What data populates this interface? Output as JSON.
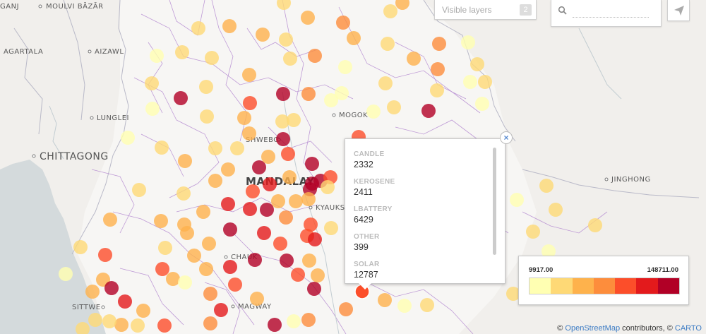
{
  "cities": [
    {
      "name": "GANJ"
    },
    {
      "name": "MOULVI BĀZĀR"
    },
    {
      "name": "AGARTALA"
    },
    {
      "name": "AIZAWL"
    },
    {
      "name": "LUNGLEI"
    },
    {
      "name": "CHITTAGONG"
    },
    {
      "name": "SHWEBO"
    },
    {
      "name": "MANDALAY"
    },
    {
      "name": "KYAUKSE"
    },
    {
      "name": "MOGOK"
    },
    {
      "name": "CHAUK"
    },
    {
      "name": "MAGWAY"
    },
    {
      "name": "SITTWE"
    },
    {
      "name": "JINGHONG"
    }
  ],
  "layers_control": {
    "label": "Visible layers",
    "count": "2"
  },
  "search": {
    "placeholder": ""
  },
  "popup": {
    "fields": [
      {
        "name": "CANDLE",
        "value": "2332"
      },
      {
        "name": "KEROSENE",
        "value": "2411"
      },
      {
        "name": "LBATTERY",
        "value": "6429"
      },
      {
        "name": "OTHER",
        "value": "399"
      },
      {
        "name": "SOLAR",
        "value": "12787"
      }
    ]
  },
  "legend": {
    "min": "9917.00",
    "max": "148711.00",
    "colors": [
      "#ffffb2",
      "#fed976",
      "#feb24c",
      "#fd8d3c",
      "#fc4e2a",
      "#e31a1c",
      "#b10026"
    ]
  },
  "attribution": {
    "prefix": "© ",
    "osm": "OpenStreetMap",
    "middle": " contributors, © ",
    "carto": "CARTO"
  }
}
